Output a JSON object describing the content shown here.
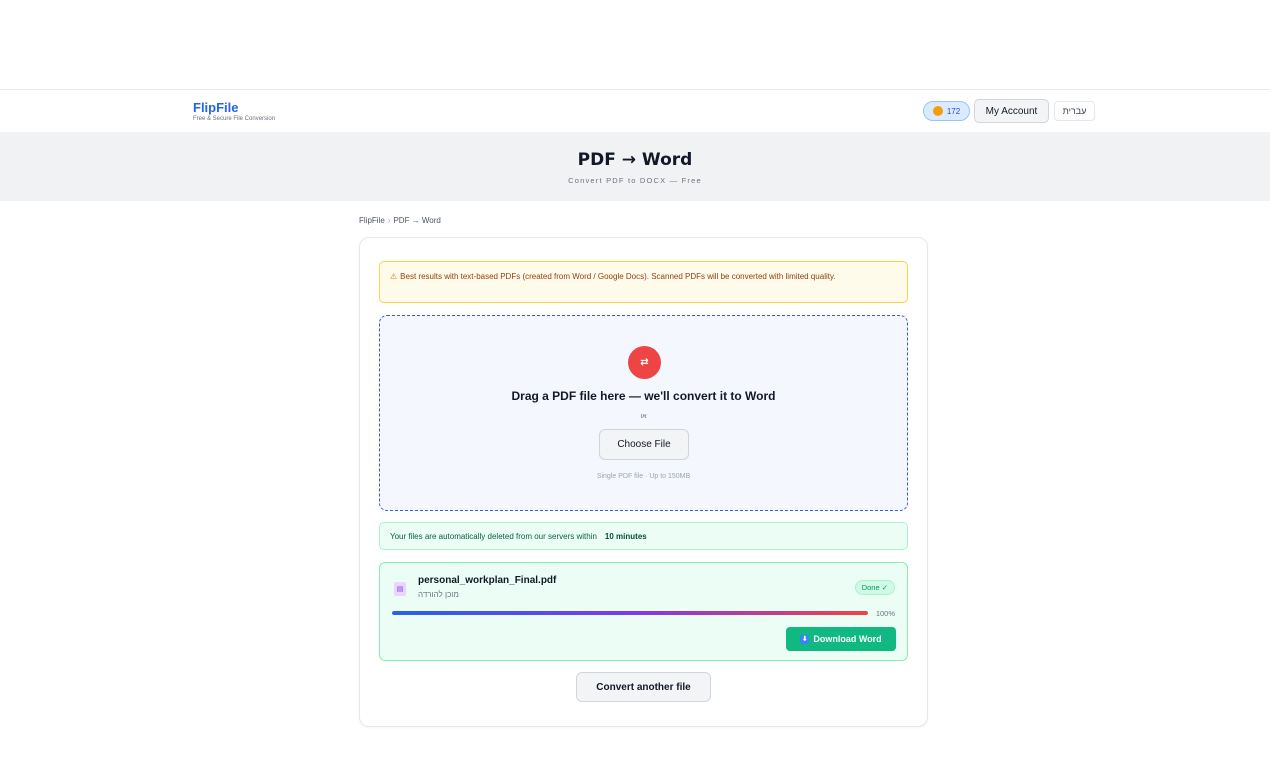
{
  "header": {
    "brand_name": "FlipFile",
    "brand_tagline": "Free & Secure File Conversion",
    "credits": "172",
    "account_label": "My Account",
    "language_label": "עברית"
  },
  "hero": {
    "title": "PDF → Word",
    "subtitle": "Convert PDF to DOCX — Free"
  },
  "breadcrumb": {
    "home": "FlipFile",
    "separator": "›",
    "current": "PDF → Word"
  },
  "warning": {
    "icon": "⚠",
    "text": "Best results with text-based PDFs (created from Word / Google Docs). Scanned PDFs will be converted with limited quality."
  },
  "dropzone": {
    "icon": "⇄",
    "title": "Drag a PDF file here — we'll convert it to Word",
    "or": "או",
    "choose_label": "Choose File",
    "hint": "Single PDF file · Up to 150MB"
  },
  "notice": {
    "text": "Your files are automatically deleted from our servers within",
    "strong": "10 minutes"
  },
  "file": {
    "name": "personal_workplan_Final.pdf",
    "status": "מוכן להורדה",
    "badge": "Done ✓",
    "progress_percent": 100,
    "progress_label": "100%",
    "download_label": "Download Word",
    "download_icon": "⬇"
  },
  "actions": {
    "convert_another": "Convert another file"
  },
  "colors": {
    "brand": "#2563eb",
    "success": "#10b981",
    "warning_bg": "#fffbeb",
    "dropzone_border": "#3b5bdb"
  }
}
